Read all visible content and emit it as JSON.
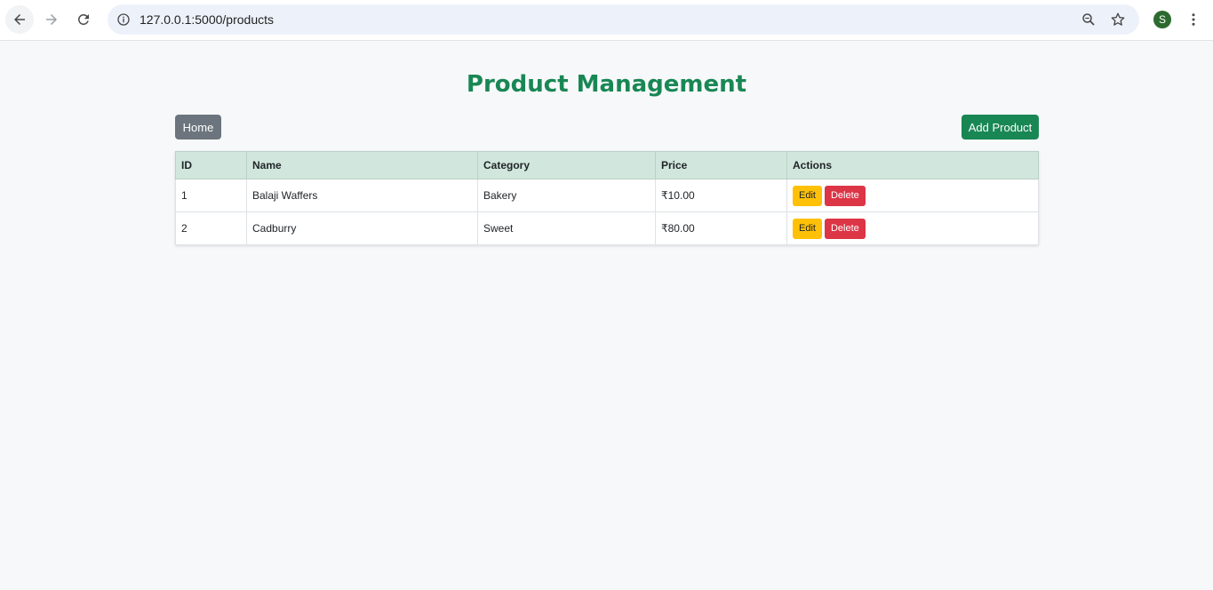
{
  "browser": {
    "url": "127.0.0.1:5000/products",
    "profile_initial": "S"
  },
  "page": {
    "title": "Product Management",
    "home_label": "Home",
    "add_label": "Add Product"
  },
  "table": {
    "headers": [
      "ID",
      "Name",
      "Category",
      "Price",
      "Actions"
    ],
    "rows": [
      {
        "id": "1",
        "name": "Balaji Waffers",
        "category": "Bakery",
        "price": "₹10.00",
        "edit": "Edit",
        "delete": "Delete"
      },
      {
        "id": "2",
        "name": "Cadburry",
        "category": "Sweet",
        "price": "₹80.00",
        "edit": "Edit",
        "delete": "Delete"
      }
    ]
  },
  "colors": {
    "accent": "#198754",
    "secondary": "#6c757d",
    "warning": "#ffc107",
    "danger": "#dc3545",
    "header_bg": "#d1e7dd"
  },
  "icons": [
    "back-arrow-icon",
    "forward-arrow-icon",
    "reload-icon",
    "site-info-icon",
    "zoom-icon",
    "star-icon",
    "kebab-menu-icon"
  ]
}
